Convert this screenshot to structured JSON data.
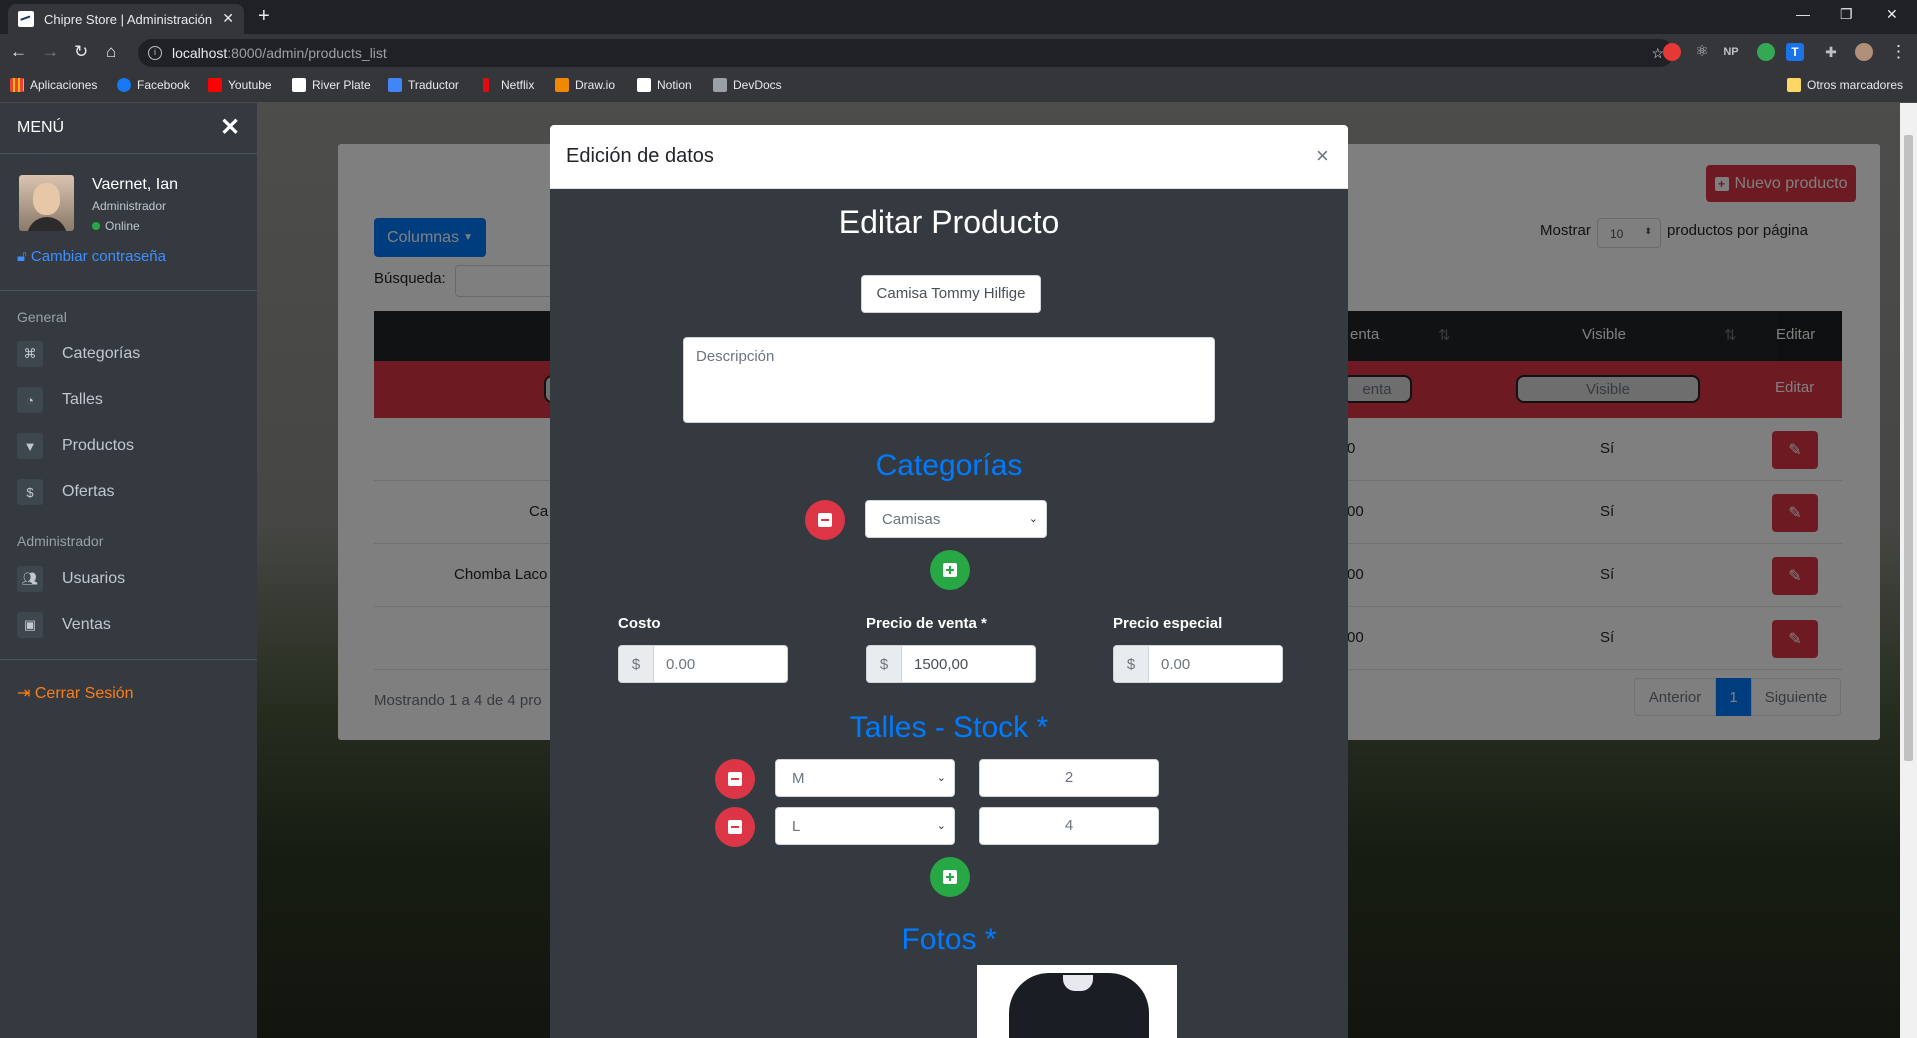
{
  "browser": {
    "tab_title": "Chipre Store | Administración",
    "url_host": "localhost",
    "url_path": ":8000/admin/products_list",
    "bookmarks": [
      "Aplicaciones",
      "Facebook",
      "Youtube",
      "River Plate",
      "Traductor",
      "Netflix",
      "Draw.io",
      "Notion",
      "DevDocs"
    ],
    "other_bookmarks": "Otros marcadores"
  },
  "sidebar": {
    "title": "MENÚ",
    "user_name": "Vaernet, Ian",
    "user_role": "Administrador",
    "user_status": "Online",
    "change_password": "Cambiar contraseña",
    "section_general": "General",
    "general_items": [
      "Categorías",
      "Talles",
      "Productos",
      "Ofertas"
    ],
    "section_admin": "Administrador",
    "admin_items": [
      "Usuarios",
      "Ventas"
    ],
    "logout": "Cerrar Sesión"
  },
  "page": {
    "columns_button": "Columnas",
    "search_label": "Búsqueda:",
    "new_product_button": "Nuevo producto",
    "show_label": "Mostrar",
    "show_value": "10",
    "per_page_label": "productos por página",
    "headers": {
      "venta": "enta",
      "visible": "Visible",
      "editar": "Editar"
    },
    "filters": {
      "venta": "enta",
      "visible": "Visible",
      "editar": "Editar"
    },
    "rows": [
      {
        "name": "",
        "venta": "0",
        "visible": "Sí"
      },
      {
        "name": "Ca",
        "venta": "00",
        "visible": "Sí"
      },
      {
        "name": "Chomba Laco",
        "venta": "00",
        "visible": "Sí"
      },
      {
        "name": "",
        "venta": "00",
        "visible": "Sí"
      }
    ],
    "footer": "Mostrando 1 a 4 de 4 pro",
    "pager": {
      "prev": "Anterior",
      "current": "1",
      "next": "Siguiente"
    }
  },
  "modal": {
    "header_title": "Edición de datos",
    "close": "×",
    "heading": "Editar Producto",
    "name_value": "Camisa Tommy Hilfige",
    "description_placeholder": "Descripción",
    "categories_heading": "Categorías",
    "category_selected": "Camisas",
    "cost_label": "Costo",
    "cost_placeholder": "0.00",
    "price_label": "Precio de venta *",
    "price_value": "1500,00",
    "special_label": "Precio especial",
    "special_placeholder": "0.00",
    "currency": "$",
    "sizes_heading": "Talles - Stock *",
    "sizes": [
      {
        "size": "M",
        "stock": "2"
      },
      {
        "size": "L",
        "stock": "4"
      }
    ],
    "photos_heading": "Fotos *"
  },
  "colors": {
    "primary": "#007bff",
    "danger": "#dc3545",
    "success": "#28a745",
    "dark": "#343a40"
  }
}
